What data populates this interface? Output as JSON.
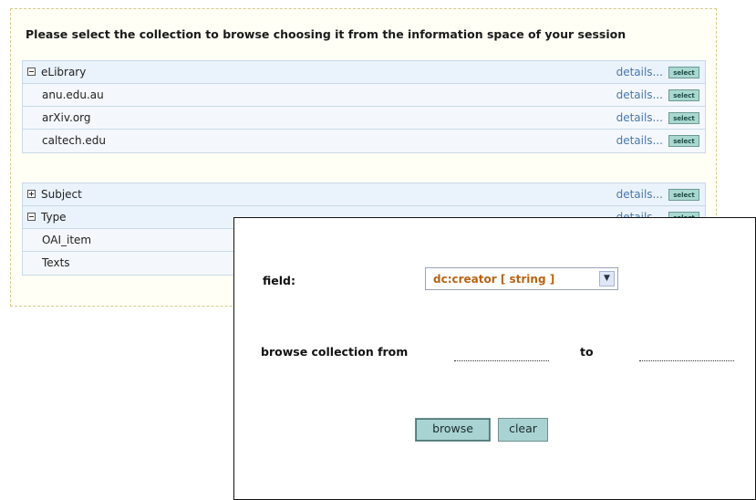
{
  "prompt": "Please select the collection to browse choosing it from the information space of your session",
  "details_label": "details...",
  "select_label": "select",
  "groups": [
    {
      "label": "eLibrary",
      "expanded": true,
      "children": [
        "anu.edu.au",
        "arXiv.org",
        "caltech.edu"
      ]
    },
    {
      "label": "Subject",
      "expanded": false,
      "children": []
    },
    {
      "label": "Type",
      "expanded": true,
      "children": [
        "OAI_item",
        "Texts"
      ]
    }
  ],
  "dialog": {
    "field_label": "field:",
    "field_value": "dc:creator [ string ]",
    "browse_from_label": "browse collection from",
    "to_label": "to",
    "browse_button": "browse",
    "clear_button": "clear"
  },
  "colors": {
    "panel_border": "#d7c98a",
    "row_bg": "#eaf2fb",
    "link": "#4a78a8",
    "select_button": "#a9d8d0",
    "field_value": "#b86414",
    "dialog_button": "#a9d3d3"
  }
}
